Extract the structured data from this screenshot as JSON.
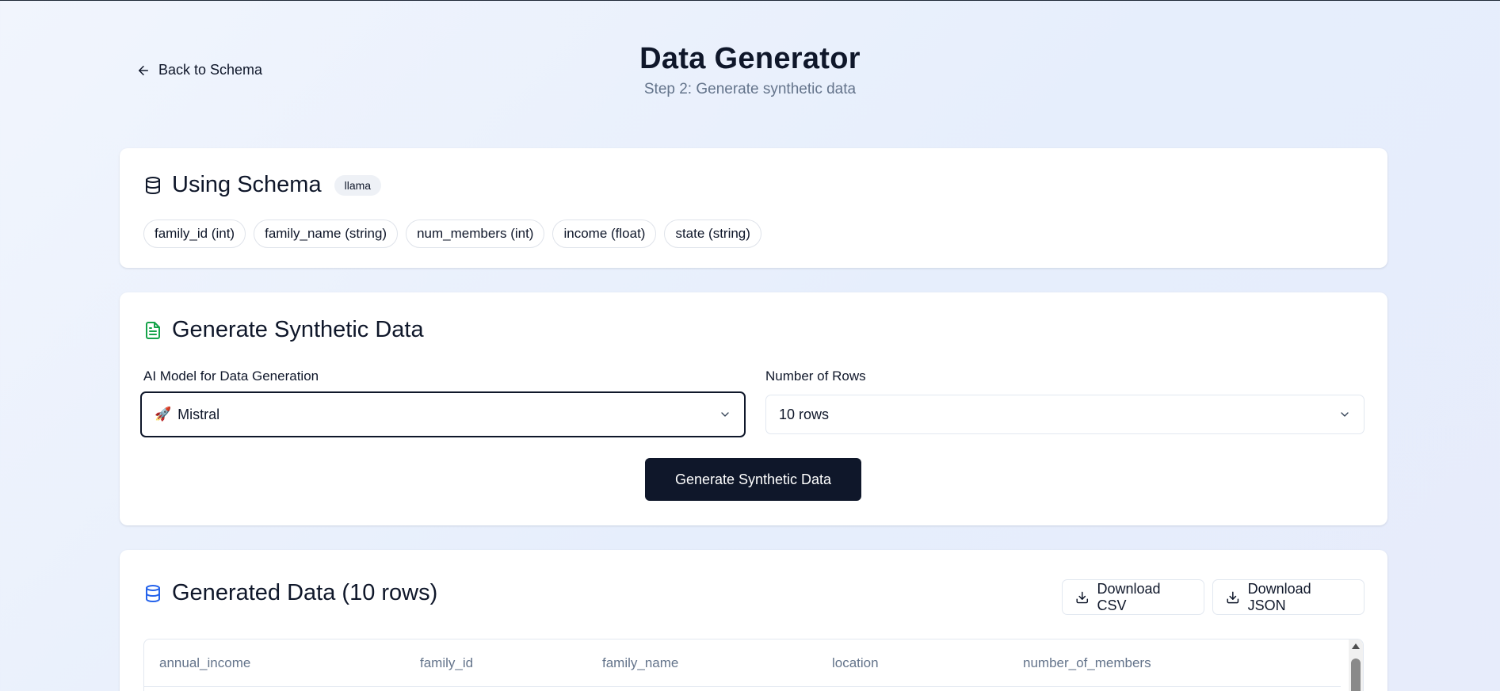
{
  "header": {
    "back_label": "Back to Schema",
    "title": "Data Generator",
    "subtitle": "Step 2: Generate synthetic data"
  },
  "schema_card": {
    "title": "Using Schema",
    "badge": "llama",
    "fields": [
      "family_id (int)",
      "family_name (string)",
      "num_members (int)",
      "income (float)",
      "state (string)"
    ],
    "icon": "database-icon"
  },
  "generate_card": {
    "title": "Generate Synthetic Data",
    "icon": "file-text-icon",
    "icon_color": "#16a34a",
    "model_label": "AI Model for Data Generation",
    "model_emoji": "🚀",
    "model_value": "Mistral",
    "rows_label": "Number of Rows",
    "rows_value": "10 rows",
    "generate_button": "Generate Synthetic Data"
  },
  "results_card": {
    "title": "Generated Data (10 rows)",
    "icon": "database-icon",
    "icon_color": "#2563eb",
    "download_csv": "Download CSV",
    "download_json": "Download JSON",
    "columns": [
      "annual_income",
      "family_id",
      "family_name",
      "location",
      "number_of_members"
    ]
  },
  "colors": {
    "primary": "#0f172a",
    "muted": "#64748b",
    "border": "#e2e8f0"
  }
}
